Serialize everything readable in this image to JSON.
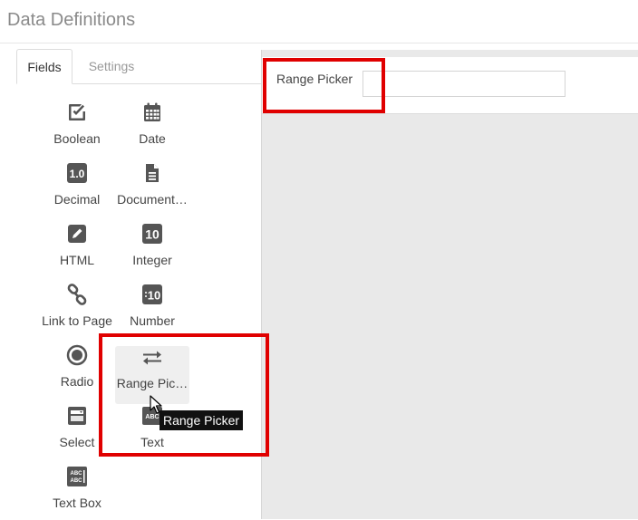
{
  "header": {
    "title": "Data Definitions"
  },
  "sidebar": {
    "tabs": [
      {
        "label": "Fields",
        "active": true
      },
      {
        "label": "Settings",
        "active": false
      }
    ],
    "fields": [
      {
        "label": "Boolean",
        "icon": "checkbox-icon"
      },
      {
        "label": "Date",
        "icon": "calendar-icon"
      },
      {
        "label": "Decimal",
        "icon": "decimal-icon"
      },
      {
        "label": "Document…",
        "icon": "document-icon"
      },
      {
        "label": "HTML",
        "icon": "pencil-icon"
      },
      {
        "label": "Integer",
        "icon": "integer-icon"
      },
      {
        "label": "Link to Page",
        "icon": "link-icon"
      },
      {
        "label": "Number",
        "icon": "number-icon"
      },
      {
        "label": "Radio",
        "icon": "radio-icon"
      },
      {
        "label": "Range Pic…",
        "icon": "arrows-exchange-icon"
      },
      {
        "label": "Select",
        "icon": "select-icon"
      },
      {
        "label": "Text",
        "icon": "text-icon"
      },
      {
        "label": "Text Box",
        "icon": "text-box-icon"
      }
    ]
  },
  "tooltip": {
    "text": "Range Picker"
  },
  "main": {
    "field_label": "Range Picker",
    "field_value": ""
  },
  "colors": {
    "highlight": "#e00000",
    "canvas_bg": "#e9e9e9",
    "icon": "#555555"
  },
  "icon_text": {
    "decimal": "1.0",
    "integer": "10",
    "number": "10",
    "text": "ABC",
    "text_box_line1": "ABC",
    "text_box_line2": "ABC"
  }
}
